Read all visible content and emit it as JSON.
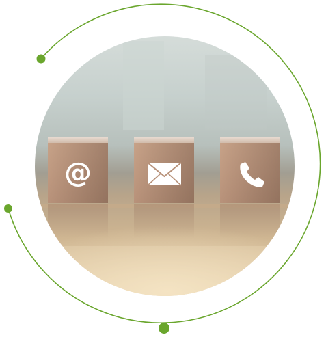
{
  "image": {
    "accent_color": "#6aa62d",
    "icons": [
      "at-sign-icon",
      "envelope-icon",
      "phone-icon"
    ]
  }
}
